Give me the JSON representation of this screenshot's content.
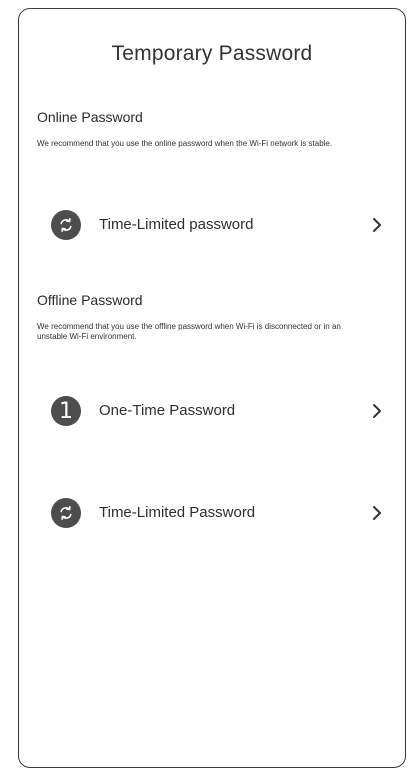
{
  "header": {
    "title": "Temporary Password"
  },
  "online": {
    "title": "Online Password",
    "description": "We recommend that you use the online password when the Wi-Fi network is stable.",
    "items": [
      {
        "label": "Time-Limited password",
        "icon": "refresh-icon"
      }
    ]
  },
  "offline": {
    "title": "Offline Password",
    "description": "We recommend that you use the offline password when Wi-Fi is disconnected or in an unstable Wi-Fi environment.",
    "items": [
      {
        "label": "One-Time Password",
        "icon": "one-time-icon",
        "icon_text": "1"
      },
      {
        "label": "Time-Limited Password",
        "icon": "refresh-icon"
      }
    ]
  },
  "colors": {
    "icon_bg": "#4d4d4d",
    "text": "#2b2b2b",
    "frame": "#3a3a3a"
  }
}
